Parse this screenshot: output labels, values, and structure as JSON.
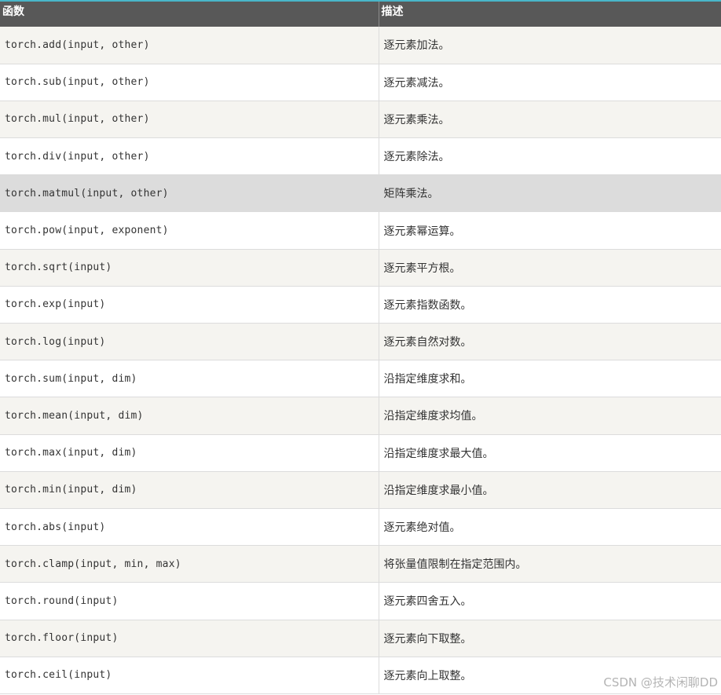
{
  "table": {
    "headers": [
      "函数",
      "描述"
    ],
    "rows": [
      {
        "fn": "torch.add(input, other)",
        "desc": "逐元素加法。"
      },
      {
        "fn": "torch.sub(input, other)",
        "desc": "逐元素减法。"
      },
      {
        "fn": "torch.mul(input, other)",
        "desc": "逐元素乘法。"
      },
      {
        "fn": "torch.div(input, other)",
        "desc": "逐元素除法。"
      },
      {
        "fn": "torch.matmul(input, other)",
        "desc": "矩阵乘法。"
      },
      {
        "fn": "torch.pow(input, exponent)",
        "desc": "逐元素幂运算。"
      },
      {
        "fn": "torch.sqrt(input)",
        "desc": "逐元素平方根。"
      },
      {
        "fn": "torch.exp(input)",
        "desc": "逐元素指数函数。"
      },
      {
        "fn": "torch.log(input)",
        "desc": "逐元素自然对数。"
      },
      {
        "fn": "torch.sum(input, dim)",
        "desc": "沿指定维度求和。"
      },
      {
        "fn": "torch.mean(input, dim)",
        "desc": "沿指定维度求均值。"
      },
      {
        "fn": "torch.max(input, dim)",
        "desc": "沿指定维度求最大值。"
      },
      {
        "fn": "torch.min(input, dim)",
        "desc": "沿指定维度求最小值。"
      },
      {
        "fn": "torch.abs(input)",
        "desc": "逐元素绝对值。"
      },
      {
        "fn": "torch.clamp(input, min, max)",
        "desc": "将张量值限制在指定范围内。"
      },
      {
        "fn": "torch.round(input)",
        "desc": "逐元素四舍五入。"
      },
      {
        "fn": "torch.floor(input)",
        "desc": "逐元素向下取整。"
      },
      {
        "fn": "torch.ceil(input)",
        "desc": "逐元素向上取整。"
      }
    ]
  },
  "watermark": "CSDN @技术闲聊DD",
  "colors": {
    "header_bg": "#585858",
    "accent_top": "#49b6c9",
    "row_odd": "#f5f4f0",
    "row_even": "#ffffff",
    "row_highlight": "#dcdcdc"
  }
}
